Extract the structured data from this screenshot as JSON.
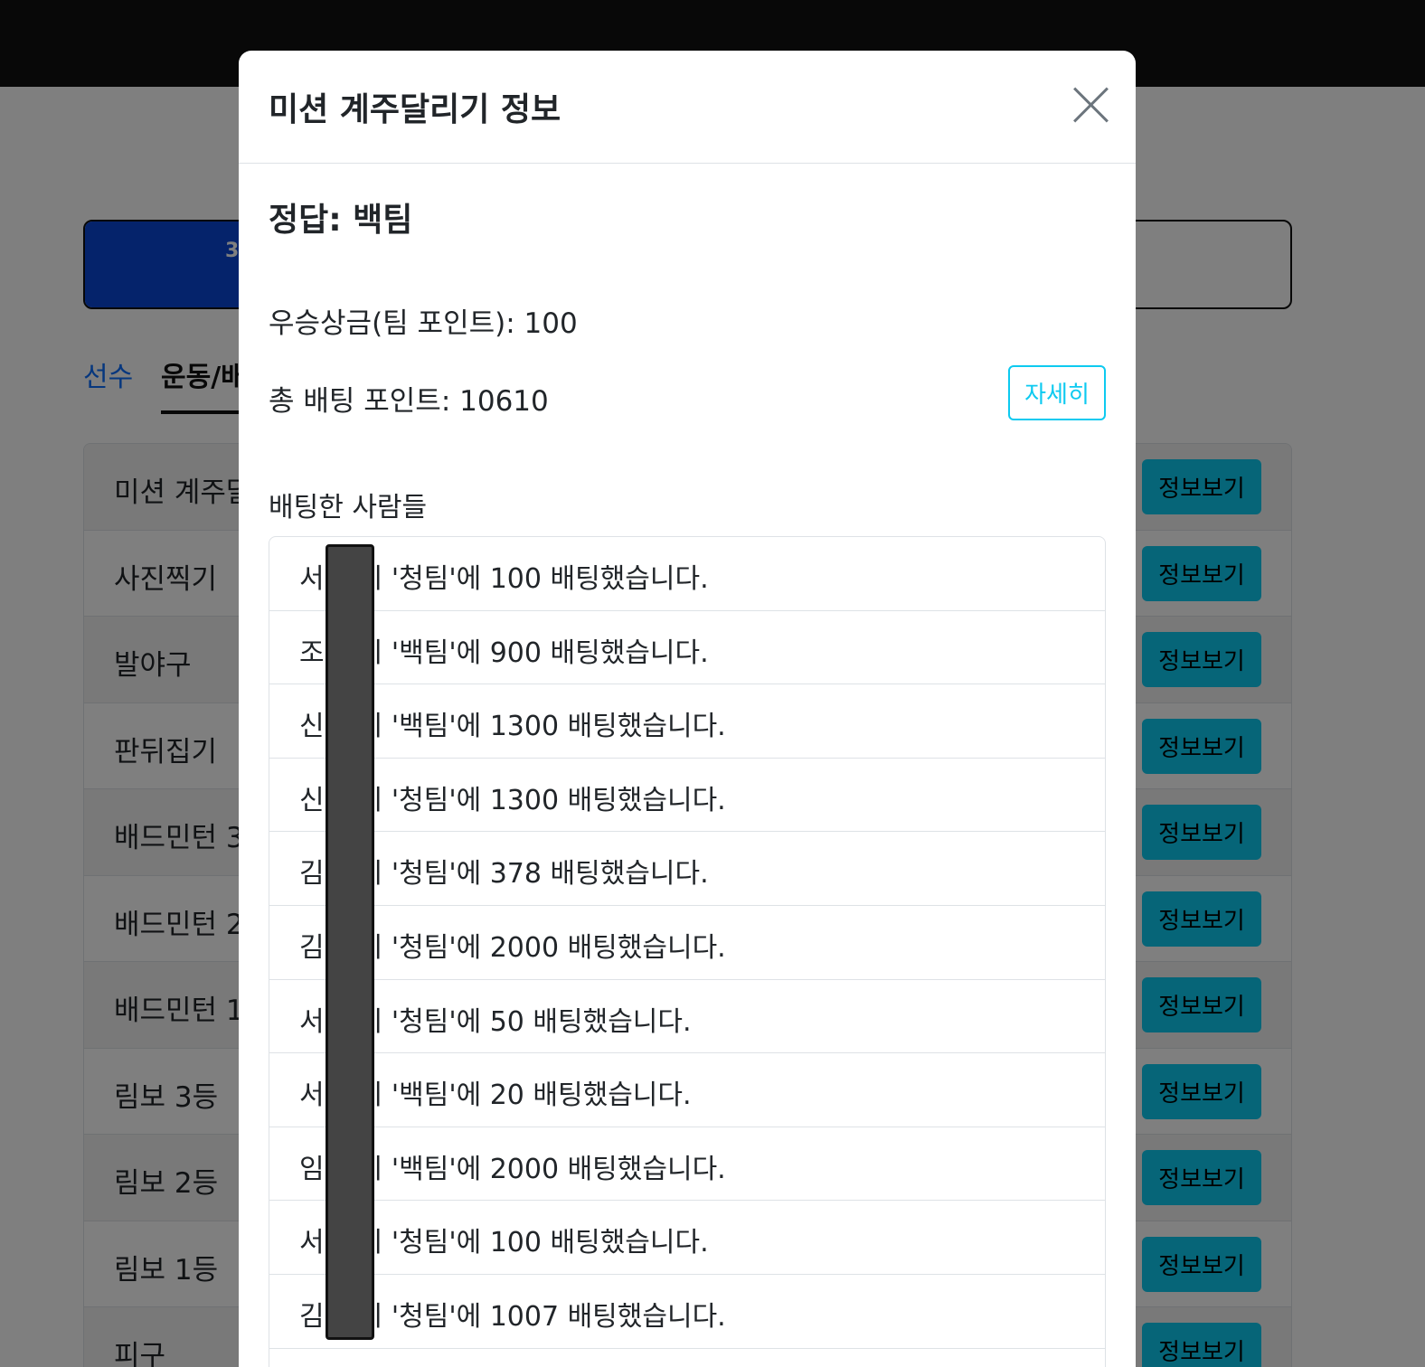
{
  "background": {
    "banner_text": "3",
    "tabs": [
      "선수",
      "운동/배"
    ],
    "events": [
      "미션 계주달",
      "사진찍기",
      "발야구",
      "판뒤집기",
      "배드민턴 3",
      "배드민턴 2",
      "배드민턴 1",
      "림보 3등",
      "림보 2등",
      "림보 1등",
      "피구"
    ],
    "info_button_label": "정보보기"
  },
  "modal": {
    "title": "미션 계주달리기 정보",
    "answer": "정답: 백팀",
    "prize": "우승상금(팀 포인트): 100",
    "total": "총 배팅 포인트: 10610",
    "detail_button": "자세히",
    "bettors_title": "배팅한 사람들",
    "bets": [
      "서     님이 '청팀'에 100 배팅했습니다.",
      "조     님이 '백팀'에 900 배팅했습니다.",
      "신     님이 '백팀'에 1300 배팅했습니다.",
      "신     님이 '청팀'에 1300 배팅했습니다.",
      "김     님이 '청팀'에 378 배팅했습니다.",
      "김     님이 '청팀'에 2000 배팅했습니다.",
      "서     님이 '청팀'에 50 배팅했습니다.",
      "서     님이 '백팀'에 20 배팅했습니다.",
      "임     님이 '백팀'에 2000 배팅했습니다.",
      "서     님이 '청팀'에 100 배팅했습니다.",
      "김     님이 '청팀'에 1007 배팅했습니다."
    ]
  }
}
